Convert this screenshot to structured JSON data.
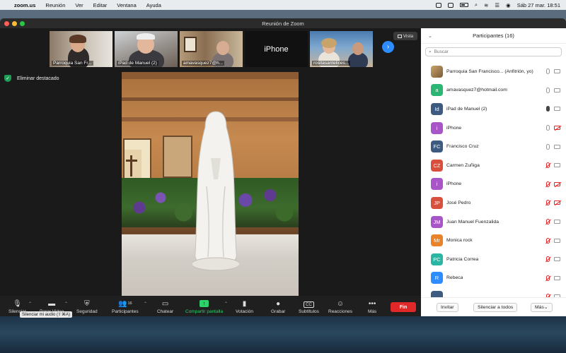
{
  "menubar": {
    "app": "zoom.us",
    "items": [
      "Reunión",
      "Ver",
      "Editar",
      "Ventana",
      "Ayuda"
    ],
    "datetime": "Sáb 27 mar.  18:51"
  },
  "window": {
    "title": "Reunión de Zoom"
  },
  "thumbnails": [
    {
      "name": "Parroquia San Fr..."
    },
    {
      "name": "iPad de Manuel (2)"
    },
    {
      "name": "amavasquez7@h..."
    },
    {
      "name": "iPhone"
    },
    {
      "name": "rositasantelices..."
    }
  ],
  "view_button": "Vista",
  "unspotlight_label": "Eliminar destacado",
  "toolbar": {
    "mute": "Silenciar",
    "video": "Parar Video",
    "security": "Seguridad",
    "participants": "Participantes",
    "participants_count": "16",
    "chat": "Chatear",
    "share": "Compartir pantalla",
    "poll": "Votación",
    "record": "Grabar",
    "subtitles": "Subtítulos",
    "subtitles_badge": "CC",
    "reactions": "Reacciones",
    "more": "Más",
    "end": "Fin",
    "tooltip": "Silenciar mi audio (⇧⌘A)"
  },
  "panel": {
    "title": "Participantes (16)",
    "search_placeholder": "Buscar",
    "participants": [
      {
        "name": "Parroquia San Francisco... (Anfitrión, yo)",
        "initials": "",
        "color": "",
        "mic": "normal",
        "cam": "normal"
      },
      {
        "name": "amavasquez7@hotmail.com",
        "initials": "a",
        "color": "#2bb673",
        "mic": "normal",
        "cam": "normal"
      },
      {
        "name": "iPad de Manuel (2)",
        "initials": "Id",
        "color": "#3d5a80",
        "mic": "on",
        "cam": "normal"
      },
      {
        "name": "iPhone",
        "initials": "i",
        "color": "#a855c7",
        "mic": "normal",
        "cam": "off"
      },
      {
        "name": "Francisco Cruz",
        "initials": "FC",
        "color": "#3d5a80",
        "mic": "normal",
        "cam": "normal"
      },
      {
        "name": "Carmen Zuñiga",
        "initials": "CZ",
        "color": "#d94f3d",
        "mic": "muted",
        "cam": "normal"
      },
      {
        "name": "iPhone",
        "initials": "i",
        "color": "#a855c7",
        "mic": "muted",
        "cam": "off"
      },
      {
        "name": "José Pedro",
        "initials": "JP",
        "color": "#d94f3d",
        "mic": "muted",
        "cam": "off"
      },
      {
        "name": "Juan Manuel Fuenzalida",
        "initials": "JM",
        "color": "#a855c7",
        "mic": "muted",
        "cam": "normal"
      },
      {
        "name": "Monica rock",
        "initials": "Mr",
        "color": "#e8832a",
        "mic": "muted",
        "cam": "normal"
      },
      {
        "name": "Patricia Correa",
        "initials": "PC",
        "color": "#2bb6a3",
        "mic": "muted",
        "cam": "normal"
      },
      {
        "name": "Rebeca",
        "initials": "R",
        "color": "#2d8cff",
        "mic": "muted",
        "cam": "normal"
      },
      {
        "name": "",
        "initials": "",
        "color": "#3d5a80",
        "mic": "muted",
        "cam": "normal"
      }
    ],
    "invite": "Invitar",
    "mute_all": "Silenciar a todos",
    "more": "Más"
  }
}
